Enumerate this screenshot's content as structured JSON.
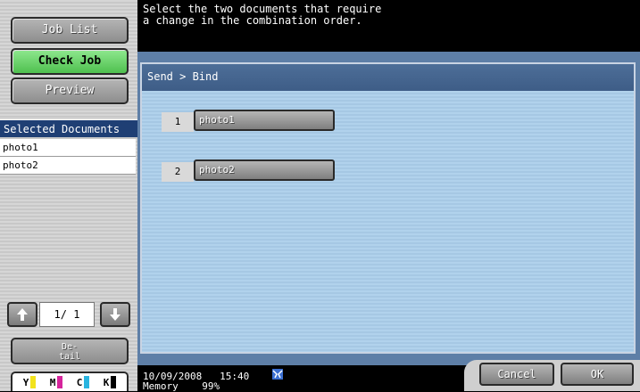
{
  "sidebar": {
    "job_list_label": "Job List",
    "check_job_label": "Check Job",
    "preview_label": "Preview",
    "selected_documents_header": "Selected Documents",
    "documents": [
      "photo1",
      "photo2"
    ],
    "pager": "1/  1",
    "detail_label_line1": "De-",
    "detail_label_line2": "tail"
  },
  "toner": [
    {
      "letter": "Y",
      "color": "#f2e21c"
    },
    {
      "letter": "M",
      "color": "#d6249c"
    },
    {
      "letter": "C",
      "color": "#29b4e0"
    },
    {
      "letter": "K",
      "color": "#000000"
    }
  ],
  "header": {
    "message_line1": "Select the two documents that require",
    "message_line2": "a change in the combination order."
  },
  "main": {
    "breadcrumb": "Send > Bind",
    "items": [
      {
        "number": "1",
        "name": "photo1"
      },
      {
        "number": "2",
        "name": "photo2"
      }
    ]
  },
  "footer": {
    "date": "10/09/2008",
    "time": "15:40",
    "memory_label": "Memory",
    "memory_value": "99%",
    "cancel_label": "Cancel",
    "ok_label": "OK"
  },
  "colors": {
    "accent_green": "#4fc04f",
    "header_blue": "#1f3f74",
    "panel_blue": "#5e7fa7"
  },
  "icons": {
    "up": "arrow-up-icon",
    "down": "arrow-down-icon",
    "network": "network-icon"
  }
}
